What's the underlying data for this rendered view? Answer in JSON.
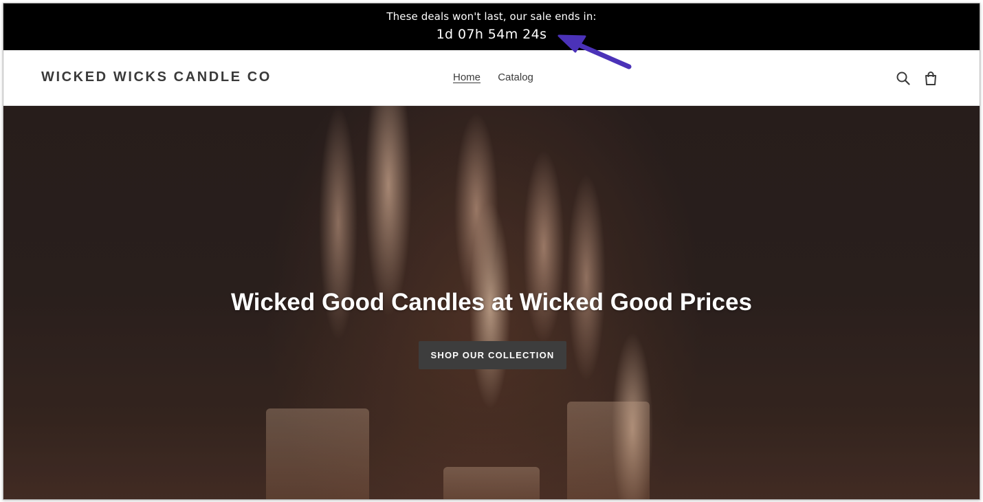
{
  "promo_bar": {
    "message": "These deals won't last, our sale ends in:",
    "countdown": "1d 07h 54m 24s"
  },
  "header": {
    "logo": "WICKED WICKS CANDLE CO",
    "nav": [
      {
        "label": "Home",
        "active": true
      },
      {
        "label": "Catalog",
        "active": false
      }
    ],
    "icons": [
      "search-icon",
      "cart-icon"
    ]
  },
  "hero": {
    "title": "Wicked Good Candles at Wicked Good Prices",
    "button_label": "SHOP OUR COLLECTION"
  },
  "colors": {
    "promo_background": "#000000",
    "header_background": "#ffffff",
    "text_dark": "#3a3a3a",
    "hero_button": "#3d3d3d",
    "annotation_arrow": "#4b32b8"
  }
}
